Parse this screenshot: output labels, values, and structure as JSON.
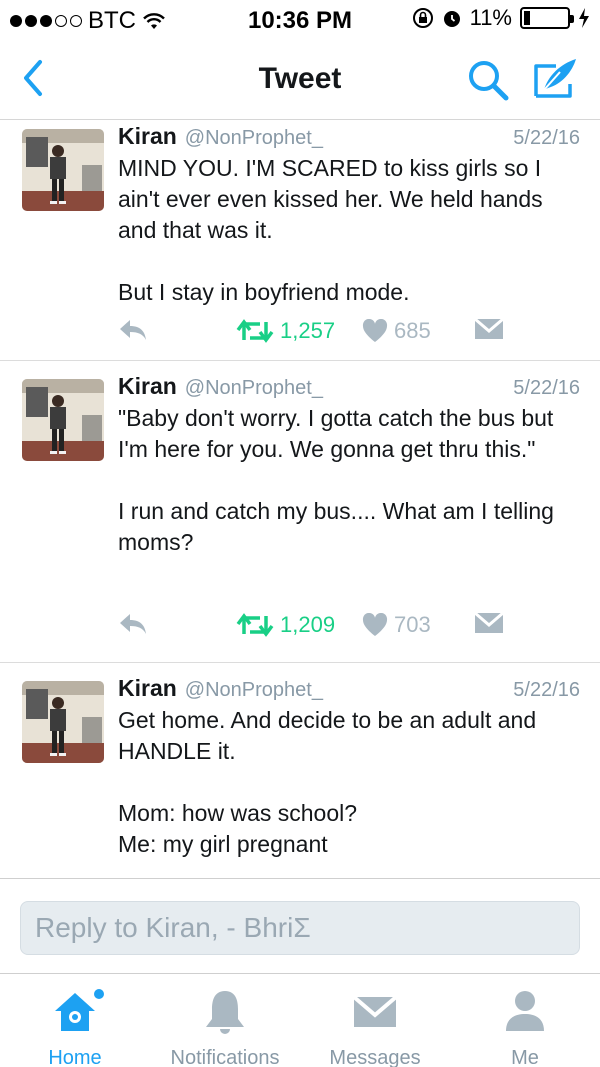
{
  "status_bar": {
    "carrier": "BTC",
    "time": "10:36 PM",
    "battery_percent": "11%",
    "signal_bars_filled": 3,
    "signal_bars_total": 5
  },
  "nav": {
    "title": "Tweet",
    "back_icon": "chevron-left-icon",
    "search_icon": "search-icon",
    "compose_icon": "compose-icon"
  },
  "tweets": [
    {
      "name": "Kiran",
      "handle": "@NonProphet_",
      "date": "5/22/16",
      "paragraphs": [
        "MIND YOU. I'M SCARED to kiss girls so I ain't ever even kissed her. We held hands and that was it.",
        "But I stay in boyfriend mode."
      ],
      "retweets": "1,257",
      "likes": "685"
    },
    {
      "name": "Kiran",
      "handle": "@NonProphet_",
      "date": "5/22/16",
      "paragraphs": [
        "\"Baby don't worry. I gotta catch the bus but I'm here for you. We gonna get thru this.\"",
        "I run and catch my bus.... What am I telling moms?"
      ],
      "retweets": "1,209",
      "likes": "703"
    },
    {
      "name": "Kiran",
      "handle": "@NonProphet_",
      "date": "5/22/16",
      "paragraphs": [
        "Get home. And decide to be an adult and HANDLE it.",
        "Mom: how was school?\nMe: my girl pregnant"
      ]
    }
  ],
  "reply": {
    "placeholder": "Reply to Kiran, - BhriΣ"
  },
  "tabs": [
    {
      "label": "Home",
      "icon": "home-icon",
      "active": true
    },
    {
      "label": "Notifications",
      "icon": "bell-icon",
      "active": false
    },
    {
      "label": "Messages",
      "icon": "envelope-icon",
      "active": false
    },
    {
      "label": "Me",
      "icon": "person-icon",
      "active": false
    }
  ],
  "colors": {
    "accent": "#1da1f2",
    "retweet": "#19cf86",
    "muted": "#8899a6",
    "like": "#aab8c2"
  }
}
